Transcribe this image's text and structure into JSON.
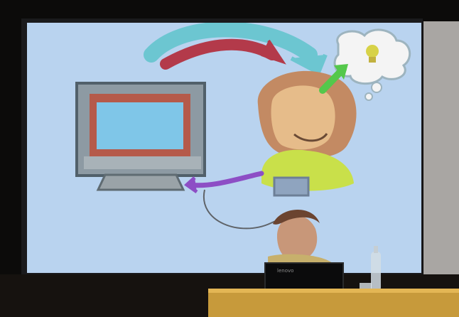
{
  "scene": {
    "description_labels": {
      "laptop_brand": "lenovo"
    }
  }
}
